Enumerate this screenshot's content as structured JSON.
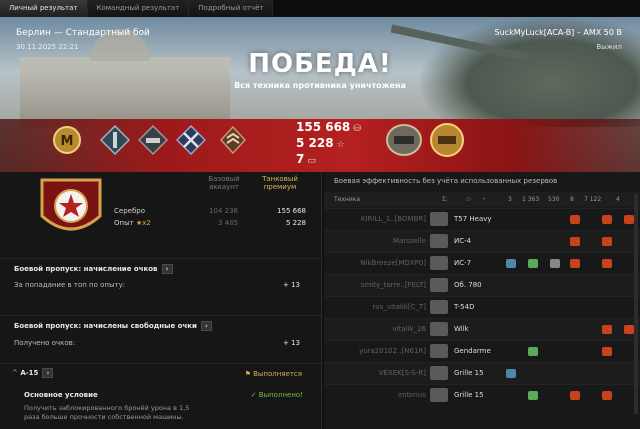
{
  "tabs": [
    "Личный результат",
    "Командный результат",
    "Подробный отчёт"
  ],
  "hero": {
    "map_mode": "Берлин — Стандартный бой",
    "date": "30.11.2025 22:21",
    "player": "SuckMyLuck[ACA-B] – AMX 50 B",
    "status": "Выжил",
    "title": "ПОБЕДА!",
    "subtitle": "Вся техника противника уничтожена",
    "credits": "155 668",
    "exp": "5 228",
    "count": "7",
    "mastery_letter": "М"
  },
  "earnings": {
    "col_base": "Базовый аккаунт",
    "col_premium": "Танковый премиум",
    "rows": [
      {
        "label": "Серебро",
        "base": "104 236",
        "premium": "155 668"
      },
      {
        "label": "Опыт",
        "mult": "x2",
        "base": "3 485",
        "premium": "5 228"
      }
    ]
  },
  "battlepass": {
    "title1": "Боевой пропуск: начисление очков",
    "line1": "За попадание в топ по опыту:",
    "val1": "+ 13",
    "title2": "Боевой пропуск: начислены свободные очки",
    "line2": "Получено очков:",
    "val2": "+ 13"
  },
  "mission": {
    "name": "А-15",
    "status": "Выполняется",
    "cond_title": "Основное условие",
    "cond_status": "✓ Выполнено!",
    "cond_desc": "Получить заблокированного бронёй урона в 1,5 раза больше прочности собственной машины."
  },
  "efficiency": {
    "title": "Боевая эффективность без учёта использованных резервов",
    "col_vehicle": "Техника",
    "col_icons": "Σ:",
    "totals": [
      "3",
      "1 363",
      "530",
      "8",
      "7 122",
      "4"
    ],
    "rows": [
      {
        "player": "KIRILL_1..[BOMBR]",
        "vehicle": "T57 Heavy"
      },
      {
        "player": "Marsselle",
        "vehicle": "ИС-4"
      },
      {
        "player": "NikBreeze[MDXP0]",
        "vehicle": "ИС-7"
      },
      {
        "player": "smity_torre..[FELT]",
        "vehicle": "Об. 780"
      },
      {
        "player": "rus_vitalik[C_T]",
        "vehicle": "T-54D"
      },
      {
        "player": "vitalik_26",
        "vehicle": "Wilk"
      },
      {
        "player": "yura20102..[N61R]",
        "vehicle": "Gendarme"
      },
      {
        "player": "VEXEK[S-S-R]",
        "vehicle": "Grille 15"
      },
      {
        "player": "imbirius",
        "vehicle": "Grille 15"
      }
    ]
  },
  "colors": {
    "accent": "#b52020",
    "gold": "#d7a34a",
    "green": "#6fbf4a"
  }
}
